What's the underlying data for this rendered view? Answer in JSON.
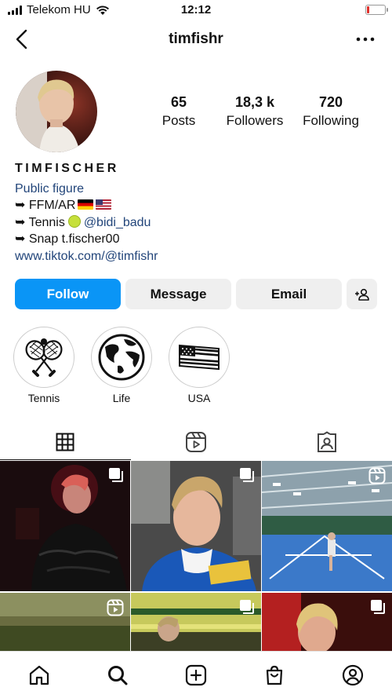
{
  "status_bar": {
    "carrier": "Telekom HU",
    "time": "12:12"
  },
  "nav": {
    "username": "timfishr"
  },
  "stats": [
    {
      "value": "65",
      "label": "Posts"
    },
    {
      "value": "18,3 k",
      "label": "Followers"
    },
    {
      "value": "720",
      "label": "Following"
    }
  ],
  "bio": {
    "name": "TIMFISCHER",
    "category": "Public figure",
    "line1": "➥ FFM/AR",
    "line2_prefix": "➥ Tennis",
    "line2_mention": "@bidi_badu",
    "line3": "➥ Snap t.fischer00",
    "link": "www.tiktok.com/@timfishr"
  },
  "buttons": {
    "follow": "Follow",
    "message": "Message",
    "email": "Email"
  },
  "highlights": [
    {
      "label": "Tennis",
      "icon": "tennis-rackets-icon"
    },
    {
      "label": "Life",
      "icon": "globe-icon"
    },
    {
      "label": "USA",
      "icon": "us-flag-icon"
    }
  ],
  "tabs": [
    "posts-grid-icon",
    "reels-icon",
    "tagged-icon"
  ],
  "bottom_nav": [
    "home-icon",
    "search-icon",
    "create-icon",
    "shop-icon",
    "profile-icon"
  ],
  "colors": {
    "follow": "#0a95f6",
    "link": "#22457a",
    "secondary_button": "#efefef"
  }
}
